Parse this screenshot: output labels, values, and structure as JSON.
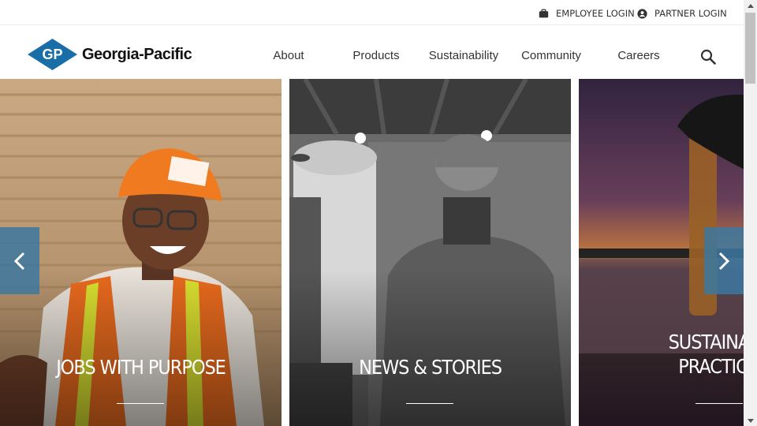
{
  "utility": {
    "employee_login": "EMPLOYEE LOGIN",
    "partner_login": "PARTNER LOGIN"
  },
  "logo": {
    "mark_text": "GP",
    "brand": "Georgia-Pacific"
  },
  "nav": {
    "items": [
      {
        "label": "About"
      },
      {
        "label": "Products"
      },
      {
        "label": "Sustainability"
      },
      {
        "label": "Community"
      },
      {
        "label": "Careers"
      }
    ],
    "search_icon": "search-icon"
  },
  "carousel": {
    "cards": [
      {
        "title": "JOBS WITH PURPOSE"
      },
      {
        "title": "NEWS & STORIES"
      },
      {
        "title_line1": "SUSTAINA",
        "title_line2": "PRACTIC"
      }
    ],
    "prev_icon": "chevron-left-icon",
    "next_icon": "chevron-right-icon"
  },
  "colors": {
    "brand_blue": "#1a6ea8",
    "arrow_bg": "#3c78a0",
    "text_dark": "#333333"
  }
}
